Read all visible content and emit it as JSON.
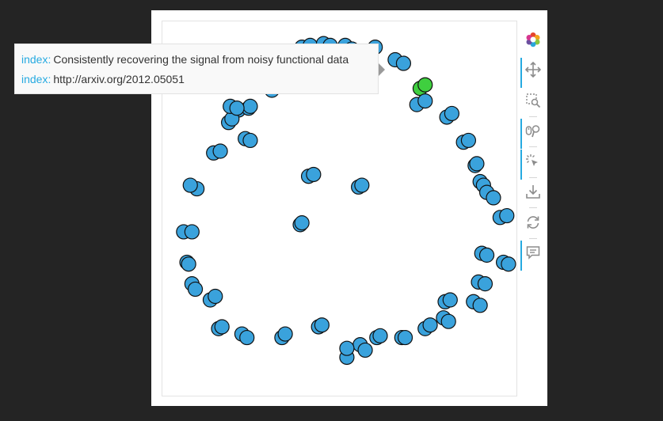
{
  "tooltip": {
    "rows": [
      {
        "label": "index:",
        "value": "Consistently recovering the signal from noisy functional data"
      },
      {
        "label": "index:",
        "value": "http://arxiv.org/2012.05051"
      }
    ]
  },
  "toolbar": {
    "tools": [
      {
        "name": "bokeh-logo-icon",
        "interactable": true,
        "active": false
      },
      {
        "name": "pan-icon",
        "interactable": true,
        "active": true
      },
      {
        "name": "box-zoom-icon",
        "interactable": true,
        "active": false
      },
      {
        "name": "wheel-zoom-icon",
        "interactable": true,
        "active": true
      },
      {
        "name": "tap-select-icon",
        "interactable": true,
        "active": true
      },
      {
        "name": "save-icon",
        "interactable": true,
        "active": false
      },
      {
        "name": "reset-icon",
        "interactable": true,
        "active": false
      },
      {
        "name": "hover-icon",
        "interactable": true,
        "active": true
      }
    ]
  },
  "colors": {
    "point_fill": "#3aa2dc",
    "point_highlight": "#3fcf3f",
    "point_stroke": "#111111",
    "accent": "#26aae1"
  },
  "chart_data": {
    "type": "scatter",
    "xlim": [
      0,
      100
    ],
    "ylim": [
      0,
      100
    ],
    "grid": false,
    "axes_visible": false,
    "highlighted_point_indices": [
      10,
      11
    ],
    "x": [
      39.5,
      42.0,
      46.0,
      48.0,
      52.5,
      54.5,
      60.0,
      61.5,
      67.5,
      70.0,
      75.0,
      76.5,
      74.0,
      76.5,
      83.0,
      84.5,
      88.0,
      89.5,
      91.5,
      92.0,
      93.0,
      94.0,
      95.0,
      97.0,
      99.0,
      101.0,
      100.0,
      101.5,
      93.5,
      95.0,
      92.5,
      94.5,
      91.0,
      93.0,
      82.5,
      84.0,
      82.0,
      83.5,
      76.5,
      78.0,
      69.5,
      70.5,
      62.0,
      63.0,
      57.0,
      58.5,
      53.0,
      53.0,
      44.5,
      45.5,
      33.5,
      34.5,
      21.5,
      23.0,
      14.5,
      15.5,
      12.0,
      13.5,
      6.5,
      7.5,
      5.0,
      5.5,
      4.0,
      6.5,
      8.0,
      6.0,
      13.0,
      15.0,
      20.5,
      23.5,
      24.0,
      30.5,
      32.0,
      31.0,
      22.5,
      24.0,
      17.5,
      18.5,
      18.0,
      20.0,
      41.5,
      43.0,
      56.5,
      57.5,
      39.0,
      39.5
    ],
    "y": [
      95.0,
      95.5,
      96.0,
      95.5,
      95.5,
      94.5,
      94.0,
      95.0,
      91.5,
      90.5,
      83.5,
      84.5,
      79.0,
      80.0,
      75.5,
      76.5,
      68.5,
      69.0,
      62.0,
      62.5,
      57.5,
      56.5,
      54.5,
      53.0,
      47.5,
      48.0,
      35.0,
      34.5,
      37.5,
      37.0,
      29.5,
      29.0,
      24.0,
      23.0,
      24.0,
      24.5,
      19.5,
      18.5,
      16.5,
      17.5,
      14.0,
      14.0,
      14.0,
      14.5,
      12.0,
      10.5,
      8.5,
      11.0,
      17.0,
      17.5,
      14.0,
      15.0,
      15.0,
      14.0,
      16.5,
      17.0,
      24.5,
      25.5,
      29.0,
      27.5,
      35.0,
      34.5,
      43.5,
      43.5,
      55.5,
      56.5,
      65.5,
      66.0,
      77.5,
      78.0,
      78.5,
      83.0,
      84.0,
      84.5,
      69.5,
      69.0,
      74.0,
      75.0,
      78.5,
      78.0,
      59.0,
      59.5,
      56.0,
      56.5,
      45.5,
      46.0
    ]
  }
}
